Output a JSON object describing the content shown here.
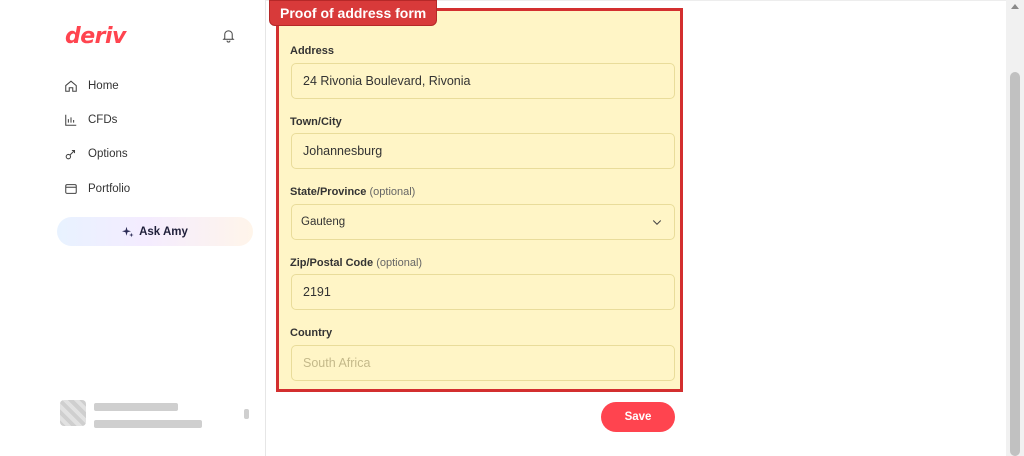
{
  "brand": {
    "logo_text": "deriv",
    "accent_color": "#ff444f"
  },
  "sidebar": {
    "items": [
      {
        "label": "Home",
        "icon": "home-icon"
      },
      {
        "label": "CFDs",
        "icon": "chart-icon"
      },
      {
        "label": "Options",
        "icon": "options-icon"
      },
      {
        "label": "Portfolio",
        "icon": "portfolio-icon"
      }
    ],
    "ask_amy": {
      "label": "Ask Amy",
      "icon": "sparkle-icon"
    }
  },
  "form": {
    "tag": "Proof of address form",
    "address": {
      "label": "Address",
      "value": "24 Rivonia Boulevard, Rivonia"
    },
    "city": {
      "label": "Town/City",
      "value": "Johannesburg"
    },
    "state": {
      "label": "State/Province",
      "optional": "(optional)",
      "value": "Gauteng"
    },
    "zip": {
      "label": "Zip/Postal Code",
      "optional": "(optional)",
      "value": "2191"
    },
    "country": {
      "label": "Country",
      "value": "South Africa"
    },
    "save_label": "Save"
  },
  "colors": {
    "panel_fill": "#fff5c6",
    "panel_border": "#d32f2f"
  }
}
